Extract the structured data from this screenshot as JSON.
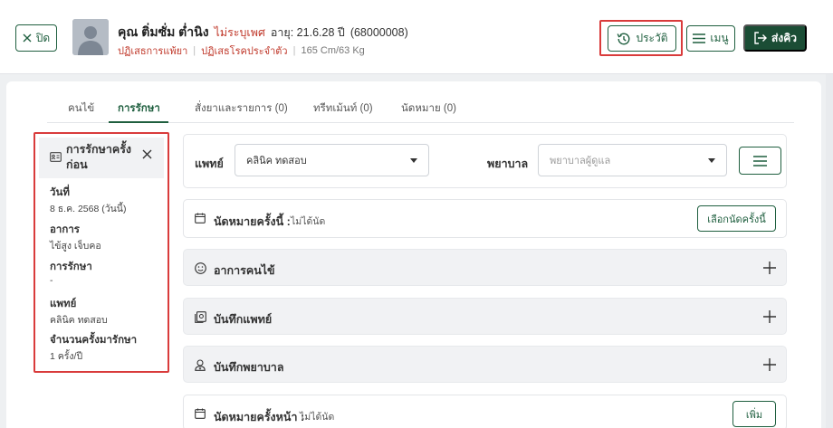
{
  "header": {
    "close_label": "ปิด",
    "patient_name": "คุณ ติ่มซั่ม ต่ำนิง",
    "gender": "ไม่ระบุเพศ",
    "age": "อายุ: 21.6.28 ปี",
    "hn": "(68000008)",
    "drug_allergy": "ปฏิเสธการแพ้ยา",
    "chronic": "ปฏิเสธโรคประจำตัว",
    "vitals": "165 Cm/63 Kg",
    "history_label": "ประวัติ",
    "menu_label": "เมนู",
    "send_queue_label": "ส่งคิว"
  },
  "tabs": [
    {
      "label": "คนไข้"
    },
    {
      "label": "การรักษา"
    },
    {
      "label": "สั่งยาและรายการ (0)"
    },
    {
      "label": "ทรีทเม้นท์ (0)"
    },
    {
      "label": "นัดหมาย (0)"
    }
  ],
  "prev_treatment": {
    "title": "การรักษาครั้งก่อน",
    "date_label": "วันที่",
    "date_value": "8 ธ.ค. 2568 (วันนี้)",
    "symptom_label": "อาการ",
    "symptom_value": "ไข้สูง เจ็บคอ",
    "treatment_label": "การรักษา",
    "treatment_value": "-",
    "doctor_label": "แพทย์",
    "doctor_value": "คลินิค ทดสอบ",
    "count_label": "จำนวนครั้งมารักษา",
    "count_value": "1 ครั้ง/ปี"
  },
  "doctor_row": {
    "doctor_label": "แพทย์",
    "doctor_value": "คลินิค ทดสอบ",
    "nurse_label": "พยาบาล",
    "nurse_placeholder": "พยาบาลผู้ดูแล"
  },
  "appt_this": {
    "title": "นัดหมายครั้งนี้ :",
    "status": "ไม่ได้นัด",
    "button": "เลือกนัดครั้งนี้"
  },
  "sections": {
    "symptom": "อาการคนไข้",
    "doctor_note": "บันทึกแพทย์",
    "nurse_note": "บันทึกพยาบาล"
  },
  "appt_next": {
    "title": "นัดหมายครั้งหน้า :",
    "status": "ไม่ได้นัด",
    "button": "เพิ่ม"
  },
  "colors": {
    "primary": "#1f5f3f",
    "primary_dark": "#1b4d35",
    "alert": "#c0392b",
    "highlight": "#d93b3b"
  }
}
